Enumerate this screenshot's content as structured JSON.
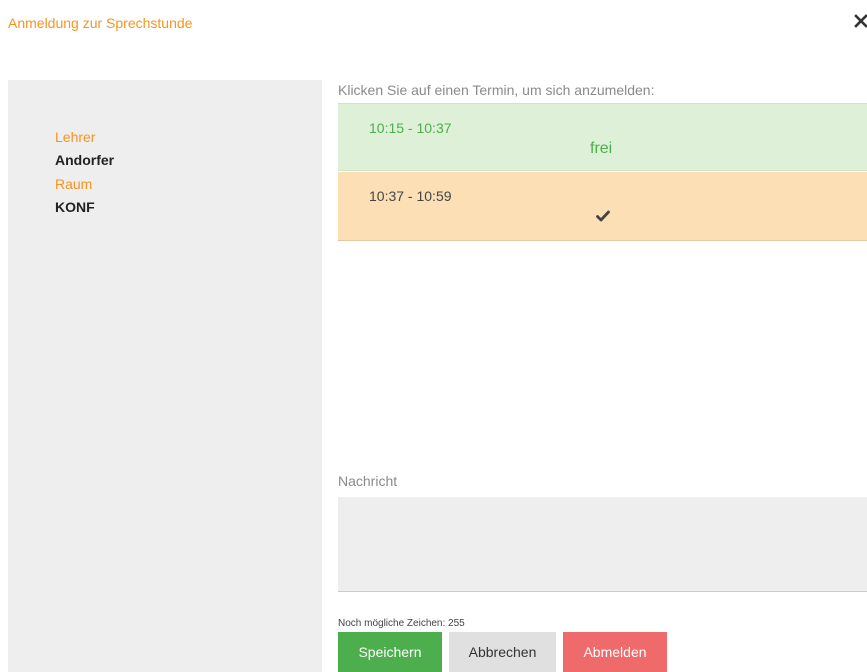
{
  "dialog": {
    "title": "Anmeldung zur Sprechstunde"
  },
  "sidebar": {
    "teacher_label": "Lehrer",
    "teacher_value": "Andorfer",
    "room_label": "Raum",
    "room_value": "KONF"
  },
  "main": {
    "instruction": "Klicken Sie auf einen Termin, um sich anzumelden:",
    "slots": [
      {
        "time": "10:15 - 10:37",
        "status": "frei",
        "state": "free"
      },
      {
        "time": "10:37 - 10:59",
        "status": "check-icon",
        "state": "booked"
      }
    ],
    "message_label": "Nachricht",
    "message_value": "",
    "char_count": "Noch mögliche Zeichen: 255"
  },
  "buttons": {
    "save": "Speichern",
    "cancel": "Abbrechen",
    "unregister": "Abmelden"
  },
  "colors": {
    "accent": "#f7941d",
    "free_bg": "#dff0d8",
    "free_text": "#4cae4c",
    "booked_bg": "#fcdfb4",
    "save": "#4cae4c",
    "cancel": "#e0e0e0",
    "unregister": "#ef6b6b"
  }
}
